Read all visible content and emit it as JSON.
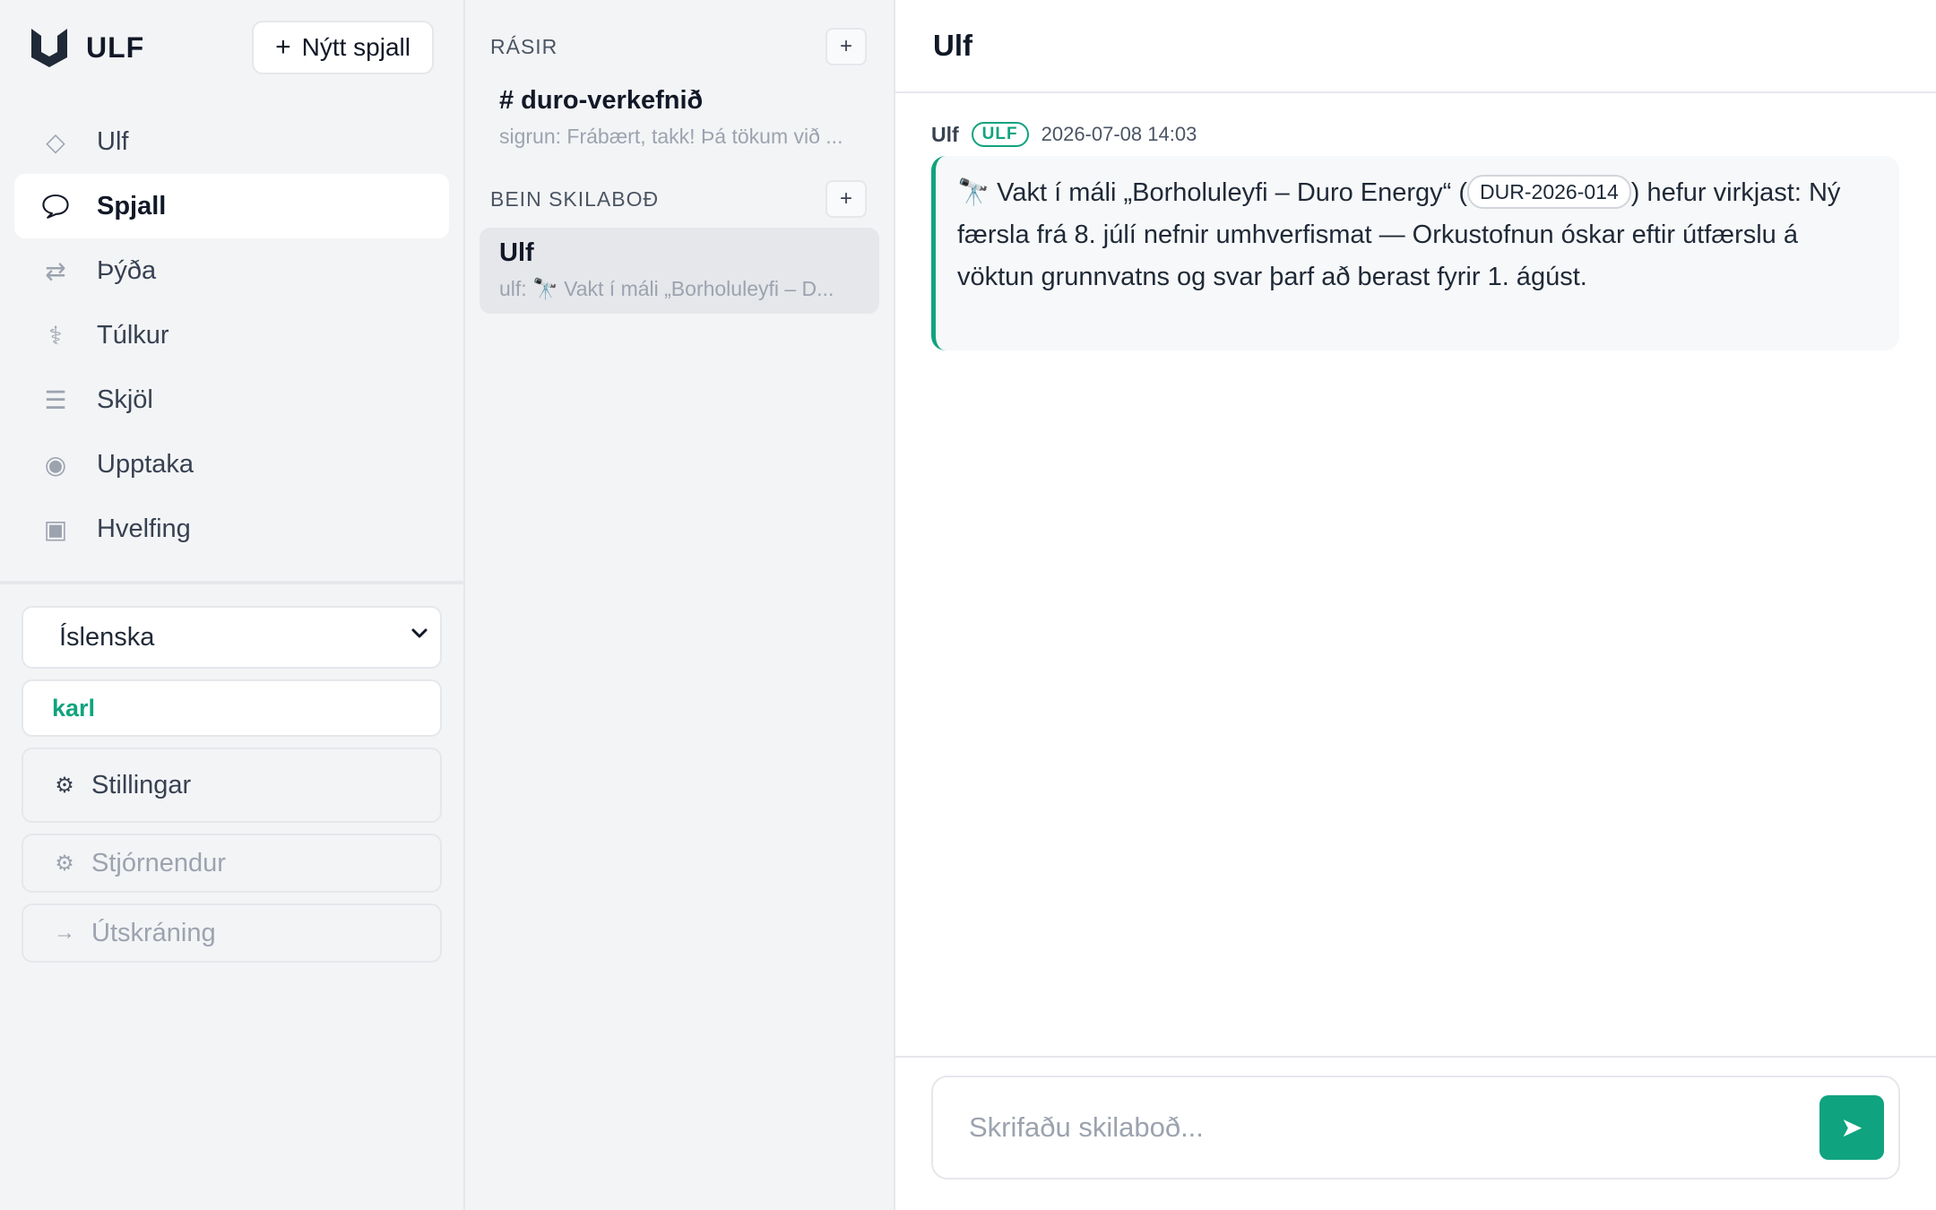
{
  "colors": {
    "accent": "#10a37f",
    "sidebar_bg": "#f3f4f6",
    "active_item_bg": "#ffffff"
  },
  "brand": {
    "name": "ULF",
    "logo_icon": "ulf-logo-icon"
  },
  "new_chat": {
    "icon": "plus-icon",
    "label": "Nýtt spjall"
  },
  "nav": {
    "items": [
      {
        "label": "Ulf",
        "icon": "diamond-icon",
        "glyph": "◇",
        "active": false
      },
      {
        "label": "Spjall",
        "icon": "chat-bubble-icon",
        "glyph": "",
        "active": true
      },
      {
        "label": "Þýða",
        "icon": "swap-arrows-icon",
        "glyph": "⇄",
        "active": false
      },
      {
        "label": "Túlkur",
        "icon": "interpreter-icon",
        "glyph": "⚕",
        "active": false
      },
      {
        "label": "Skjöl",
        "icon": "list-icon",
        "glyph": "☰",
        "active": false
      },
      {
        "label": "Upptaka",
        "icon": "record-icon",
        "glyph": "◉",
        "active": false
      },
      {
        "label": "Hvelfing",
        "icon": "vault-icon",
        "glyph": "▣",
        "active": false
      }
    ]
  },
  "language_select": {
    "value": "Íslenska",
    "icon": "chevron-down-icon"
  },
  "user": {
    "name": "karl"
  },
  "sidebar_buttons": {
    "settings": {
      "label": "Stillingar",
      "icon": "gear-icon",
      "glyph": "⚙"
    },
    "admins": {
      "label": "Stjórnendur",
      "icon": "gear-icon",
      "glyph": "⚙"
    },
    "logout": {
      "label": "Útskráning",
      "icon": "arrow-right-icon",
      "glyph": "→"
    }
  },
  "channels": {
    "section_title": "RÁSIR",
    "add_icon": "plus-icon",
    "items": [
      {
        "name": "# duro-verkefnið",
        "preview": "sigrun: Frábært, takk! Þá tökum við ..."
      }
    ]
  },
  "direct_messages": {
    "section_title": "BEIN SKILABOÐ",
    "add_icon": "plus-icon",
    "items": [
      {
        "name": "Ulf",
        "preview": "ulf: 🔭 Vakt í máli „Borholuleyfi – D...",
        "active": true
      }
    ]
  },
  "conversation": {
    "title": "Ulf",
    "messages": [
      {
        "author": "Ulf",
        "badge": "ULF",
        "time": "2026-07-08 14:03",
        "text_before": "🔭 Vakt í máli „Borholuleyfi – Duro Energy“ (",
        "case_id": "DUR-2026-014",
        "text_after": ") hefur virkjast: Ný færsla frá 8. júlí nefnir umhverfismat — Orkustofnun óskar eftir útfærslu á vöktun grunnvatns og svar þarf að berast fyrir 1. ágúst."
      }
    ]
  },
  "composer": {
    "placeholder": "Skrifaðu skilaboð...",
    "send_icon": "send-icon",
    "send_glyph": "➤"
  }
}
